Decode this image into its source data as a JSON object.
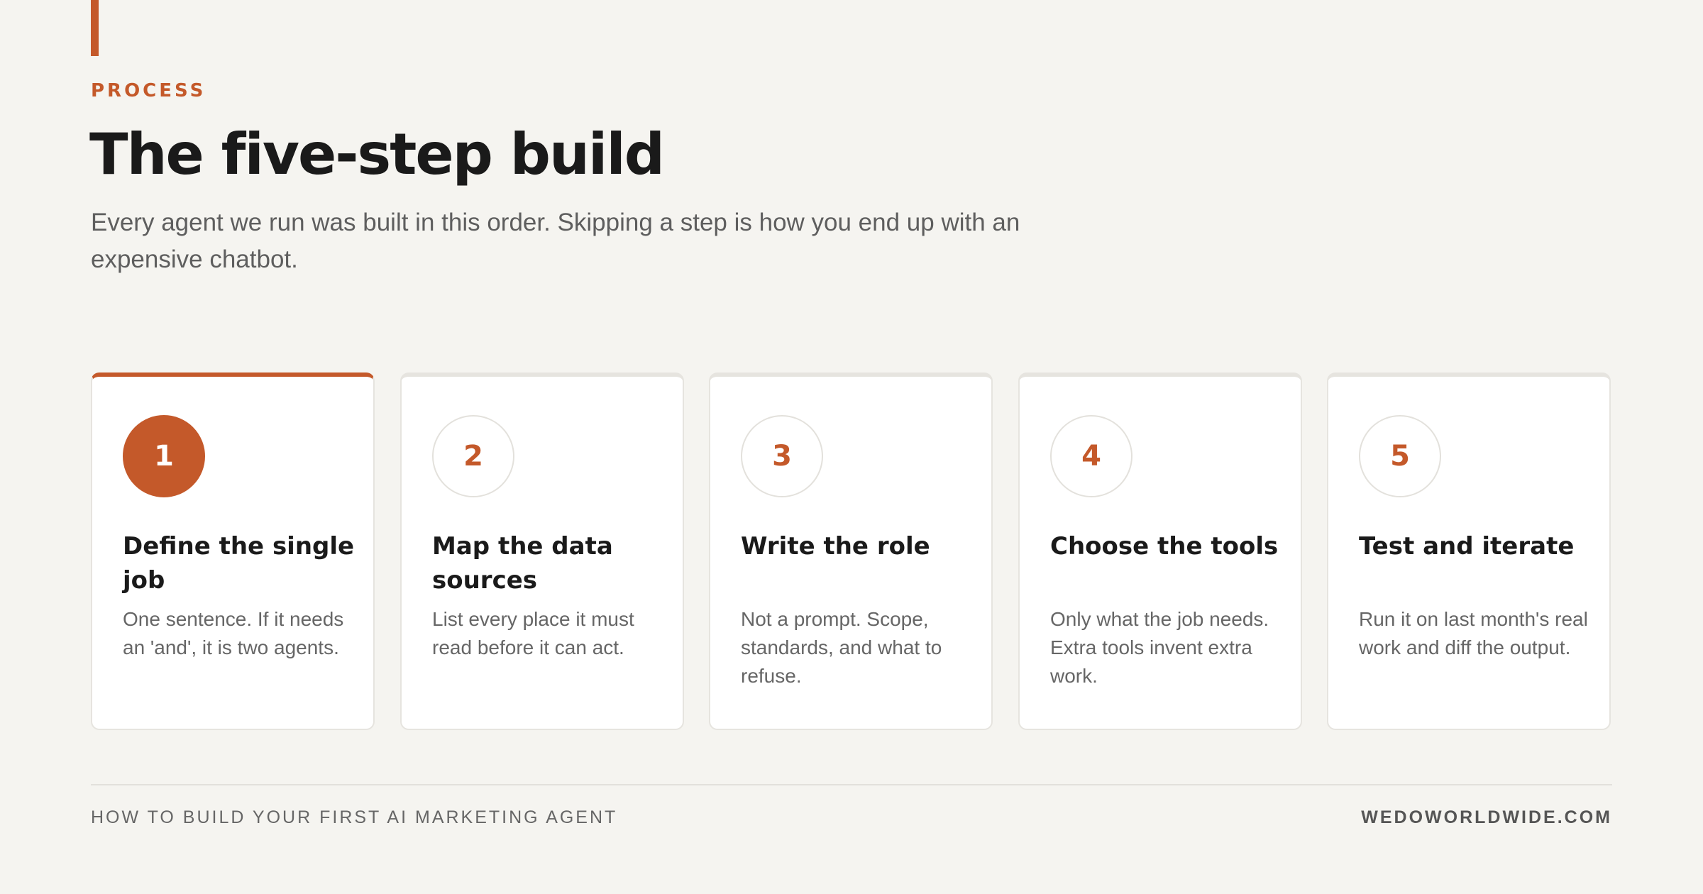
{
  "header": {
    "eyebrow": "PROCESS",
    "title": "The five-step build",
    "subtitle": "Every agent we run was built in this order. Skipping a step is how you end up with an expensive chatbot."
  },
  "steps": [
    {
      "number": "1",
      "title": "Define the single job",
      "body": "One sentence. If it needs an 'and', it is two agents.",
      "active": true
    },
    {
      "number": "2",
      "title": "Map the data sources",
      "body": "List every place it must read before it can act.",
      "active": false
    },
    {
      "number": "3",
      "title": "Write the role",
      "body": "Not a prompt. Scope, standards, and what to refuse.",
      "active": false
    },
    {
      "number": "4",
      "title": "Choose the tools",
      "body": "Only what the job needs. Extra tools invent extra work.",
      "active": false
    },
    {
      "number": "5",
      "title": "Test and iterate",
      "body": "Run it on last month's real work and diff the output.",
      "active": false
    }
  ],
  "footer": {
    "left": "HOW TO BUILD YOUR FIRST AI MARKETING AGENT",
    "right": "WEDOWORLDWIDE.COM"
  },
  "colors": {
    "accent": "#c4592a",
    "background": "#f5f4f0",
    "card": "#ffffff"
  }
}
